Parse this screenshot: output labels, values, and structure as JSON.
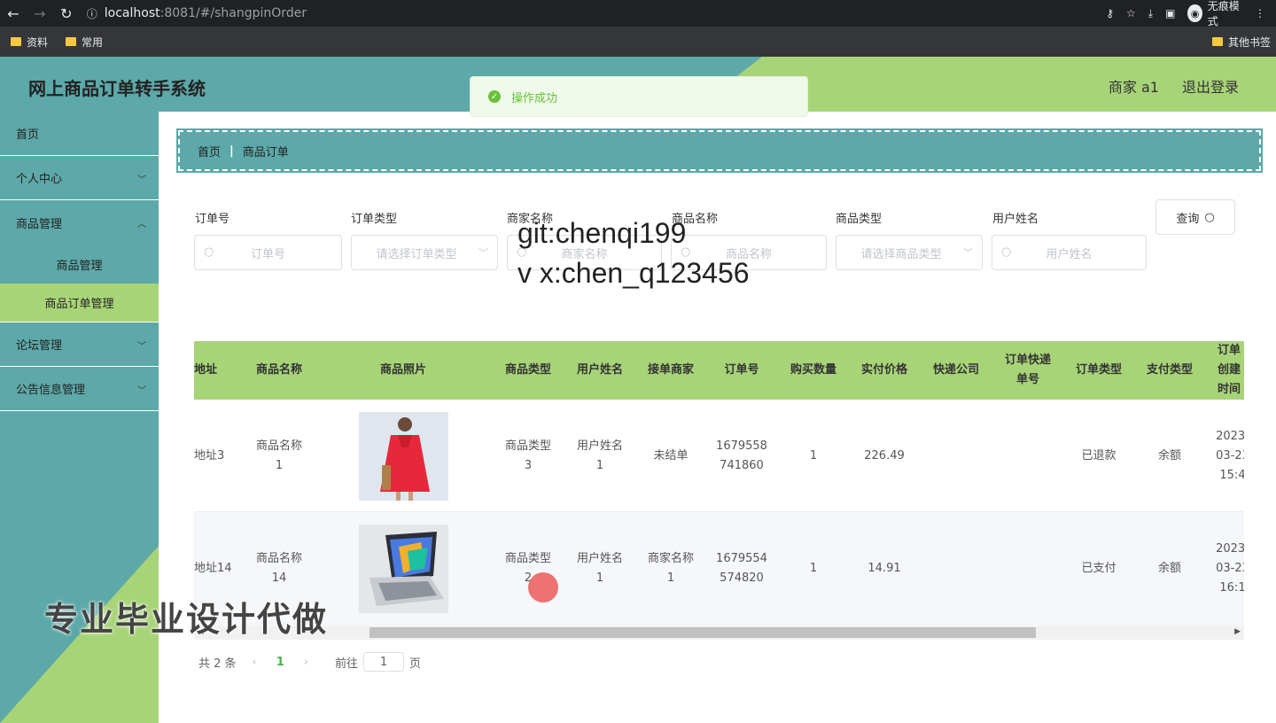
{
  "browser": {
    "url_host": "localhost",
    "url_path": ":8081/#/shangpinOrder",
    "incognito_label": "无痕模式",
    "bookmarks": [
      "资料",
      "常用"
    ],
    "other_bookmarks": "其他书签"
  },
  "header": {
    "title": "网上商品订单转手系统",
    "user": "商家 a1",
    "logout": "退出登录"
  },
  "toast": {
    "message": "操作成功"
  },
  "sidebar": {
    "items": [
      {
        "label": "首页"
      },
      {
        "label": "个人中心"
      },
      {
        "label": "商品管理"
      },
      {
        "label": "商品管理"
      },
      {
        "label": "商品订单管理"
      },
      {
        "label": "论坛管理"
      },
      {
        "label": "公告信息管理"
      }
    ]
  },
  "breadcrumb": {
    "home": "首页",
    "current": "商品订单"
  },
  "filters": [
    {
      "label": "订单号",
      "placeholder": "订单号"
    },
    {
      "label": "订单类型",
      "placeholder": "请选择订单类型"
    },
    {
      "label": "商家名称",
      "placeholder": "商家名称"
    },
    {
      "label": "商品名称",
      "placeholder": "商品名称"
    },
    {
      "label": "商品类型",
      "placeholder": "请选择商品类型"
    },
    {
      "label": "用户姓名",
      "placeholder": "用户姓名"
    }
  ],
  "query_button": "查询",
  "watermark": {
    "line1": "git:chenqi199",
    "line2": "v x:chen_q123456"
  },
  "promo_text": "专业毕业设计代做",
  "table": {
    "headers": [
      "地址",
      "商品名称",
      "商品照片",
      "商品类型",
      "用户姓名",
      "接单商家",
      "订单号",
      "购买数量",
      "实付价格",
      "快递公司",
      "订单快递单号",
      "订单类型",
      "支付类型",
      "订单创建时间"
    ],
    "rows": [
      {
        "address": "地址3",
        "name": "商品名称1",
        "type": "商品类型3",
        "user": "用户姓名1",
        "merchant": "未结单",
        "order_no": "1679558741860",
        "qty": "1",
        "price": "226.49",
        "express": "",
        "express_no": "",
        "order_type": "已退款",
        "pay_type": "余额",
        "created": "2023-03-23 15:4"
      },
      {
        "address": "地址14",
        "name": "商品名称14",
        "type": "商品类型2",
        "user": "用户姓名1",
        "merchant": "商家名称1",
        "order_no": "1679554574820",
        "qty": "1",
        "price": "14.91",
        "express": "",
        "express_no": "",
        "order_type": "已支付",
        "pay_type": "余额",
        "created": "2023-03-23 16:1"
      }
    ]
  },
  "pager": {
    "total": "共 2 条",
    "current": "1",
    "goto_label": "前往",
    "goto_value": "1",
    "page_suffix": "页"
  },
  "colors": {
    "teal": "#5da8a8",
    "green": "#a8d478"
  }
}
